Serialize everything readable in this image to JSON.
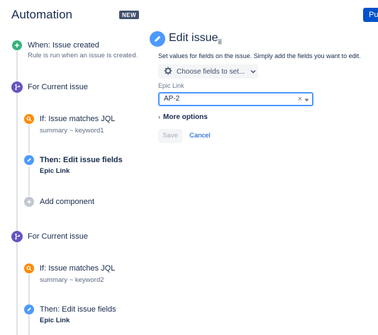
{
  "header": {
    "title": "Automation",
    "badge": "NEW",
    "publish_label": "Publish"
  },
  "rail": {
    "trigger": {
      "title": "When: Issue created",
      "subtitle": "Rule is run when an issue is created."
    },
    "branch1": {
      "title": "For Current issue",
      "condition": {
        "title": "If: Issue matches JQL",
        "subtitle": "summary ~ keyword1"
      },
      "action": {
        "title": "Then: Edit issue fields",
        "subtitle": "Epic Link"
      },
      "add": {
        "label": "Add component"
      }
    },
    "branch2": {
      "title": "For Current issue",
      "condition": {
        "title": "If: Issue matches JQL",
        "subtitle": "summary ~ keyword2"
      },
      "action": {
        "title": "Then: Edit issue fields",
        "subtitle": "Epic Link"
      }
    }
  },
  "panel": {
    "title": "Edit issue",
    "description": "Set values for fields on the issue. Simply add the fields you want to edit.",
    "choose_fields_label": "Choose fields to set...",
    "field_label": "Epic Link",
    "field_value": "AP-2",
    "clear_glyph": "×",
    "more_options_label": "More options",
    "save_label": "Save",
    "cancel_label": "Cancel"
  },
  "colors": {
    "trigger_green": "#36B37E",
    "branch_purple": "#6554C0",
    "condition_orange": "#FF8B00",
    "action_blue": "#4C9AFF",
    "add_grey": "#C1C7D0",
    "primary": "#0052CC"
  },
  "icons": [
    "plus-icon",
    "branch-icon",
    "search-icon",
    "pencil-icon",
    "trash-icon",
    "gear-icon",
    "chevron-down-icon",
    "caret-down-icon",
    "chevron-right-icon"
  ]
}
